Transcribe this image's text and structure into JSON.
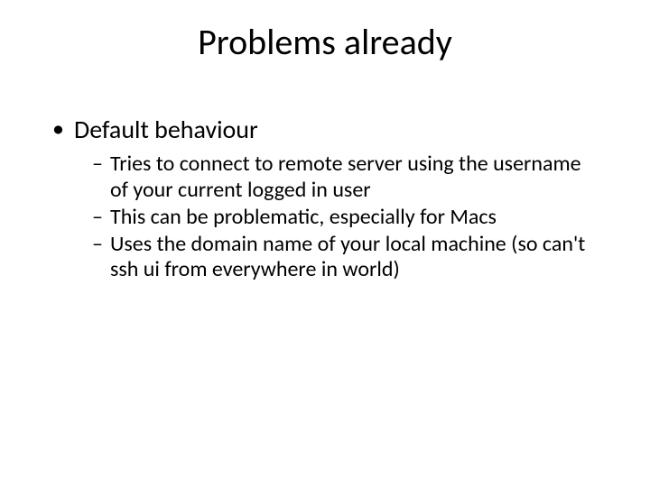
{
  "title": "Problems already",
  "bullets": {
    "l1": "Default behaviour",
    "l2": [
      "Tries to connect to remote server using the username of your current logged in user",
      "This can be problematic, especially for Macs",
      "Uses the domain name of your local machine (so can't ssh ui from everywhere in world)"
    ]
  }
}
